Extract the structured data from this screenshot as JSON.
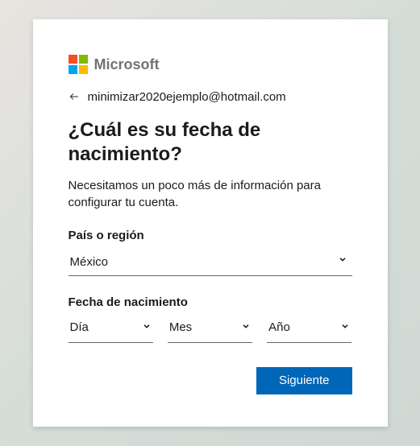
{
  "brand": {
    "name": "Microsoft"
  },
  "identity": {
    "email": "minimizar2020ejemplo@hotmail.com"
  },
  "heading": "¿Cuál es su fecha de nacimiento?",
  "description": "Necesitamos un poco más de información para configurar tu cuenta.",
  "country": {
    "label": "País o región",
    "value": "México"
  },
  "dob": {
    "label": "Fecha de nacimiento",
    "day_placeholder": "Día",
    "month_placeholder": "Mes",
    "year_placeholder": "Año"
  },
  "buttons": {
    "next": "Siguiente"
  }
}
